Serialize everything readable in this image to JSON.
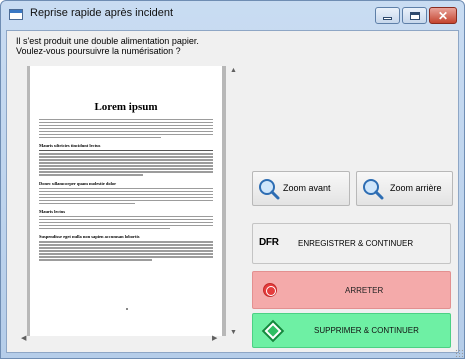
{
  "window": {
    "title": "Reprise rapide après incident",
    "close_glyph": "✕",
    "icons": {
      "app": "window-app-icon",
      "minimize": "minimize-icon",
      "maximize": "maximize-icon",
      "close": "close-icon"
    }
  },
  "message": {
    "line1": "Il s'est produit une double alimentation papier.",
    "line2": "Voulez-vous poursuivre la numérisation ?"
  },
  "preview": {
    "doc_title": "Lorem ipsum",
    "headings": [
      "Mauris ultricies tincidunt lectus",
      "Donec ullamcorper quam molestie dolor",
      "Mauris lectus",
      "Suspendisse eget nulla non sapien accumsan lobortis"
    ],
    "scroll_up": "▲",
    "scroll_down": "▼",
    "scroll_left": "◀",
    "scroll_right": "▶"
  },
  "actions": {
    "zoom_in": "Zoom avant",
    "zoom_out": "Zoom arrière",
    "save_badge": "DFR",
    "save": "ENREGISTRER & CONTINUER",
    "stop": "ARRETER",
    "delete": "SUPPRIMER & CONTINUER"
  },
  "colors": {
    "stop_bg": "#f4aaaa",
    "delete_bg": "#6ef0a4",
    "close_btn": "#c4442f",
    "title_bar": "#c9dcf2"
  }
}
